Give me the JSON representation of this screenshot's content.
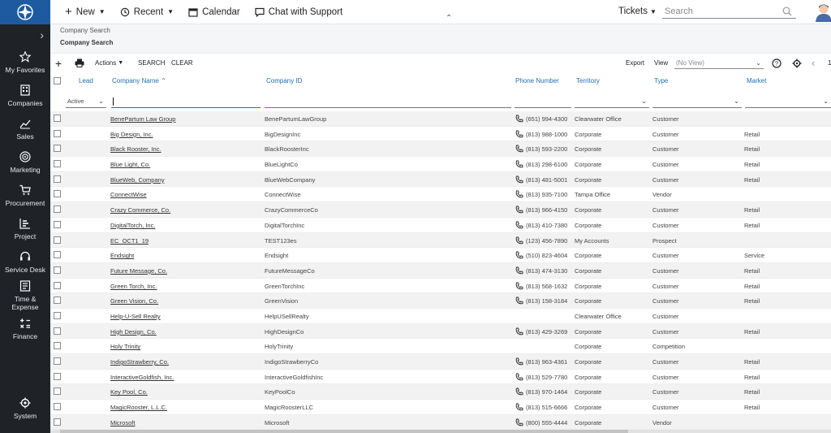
{
  "sidebar": {
    "items": [
      {
        "label": "My Favorites",
        "icon": "star-icon"
      },
      {
        "label": "Companies",
        "icon": "building-icon"
      },
      {
        "label": "Sales",
        "icon": "chart-icon"
      },
      {
        "label": "Marketing",
        "icon": "target-icon"
      },
      {
        "label": "Procurement",
        "icon": "cart-icon"
      },
      {
        "label": "Project",
        "icon": "project-icon"
      },
      {
        "label": "Service Desk",
        "icon": "headset-icon"
      },
      {
        "label": "Time &\nExpense",
        "icon": "time-expense-icon"
      },
      {
        "label": "Finance",
        "icon": "calculator-icon"
      }
    ],
    "system": "System"
  },
  "topbar": {
    "new": "New",
    "recent": "Recent",
    "calendar": "Calendar",
    "chat": "Chat with Support",
    "tickets": "Tickets",
    "search_placeholder": "Search"
  },
  "breadcrumb": {
    "parent": "Company Search",
    "current": "Company Search"
  },
  "toolbar": {
    "actions": "Actions",
    "search": "SEARCH",
    "clear": "CLEAR",
    "export": "Export",
    "view_label": "View",
    "view_value": "(No View)",
    "page_number": "1"
  },
  "columns": {
    "lead": "Lead",
    "company_name": "Company Name",
    "company_id": "Company ID",
    "phone": "Phone Number",
    "territory": "Territory",
    "type": "Type",
    "market": "Market"
  },
  "filters": {
    "status": "Active"
  },
  "rows": [
    {
      "name": "BenePartum Law Group",
      "id": "BenePartumLawGroup",
      "phone": "(651) 994-4300",
      "territory": "Clearwater Office",
      "type": "Customer",
      "market": ""
    },
    {
      "name": "Big Design, Inc.",
      "id": "BigDesignInc",
      "phone": "(813) 988-1000",
      "territory": "Corporate",
      "type": "Customer",
      "market": "Retail"
    },
    {
      "name": "Black Rooster, Inc.",
      "id": "BlackRoosterInc",
      "phone": "(813) 593-2200",
      "territory": "Corporate",
      "type": "Customer",
      "market": "Retail"
    },
    {
      "name": "Blue Light, Co.",
      "id": "BlueLightCo",
      "phone": "(813) 298-6100",
      "territory": "Corporate",
      "type": "Customer",
      "market": "Retail"
    },
    {
      "name": "BlueWeb, Company",
      "id": "BlueWebCompany",
      "phone": "(813) 481-5001",
      "territory": "Corporate",
      "type": "Customer",
      "market": "Retail"
    },
    {
      "name": "ConnectWise",
      "id": "ConnectWise",
      "phone": "(813) 935-7100",
      "territory": "Tampa Office",
      "type": "Vendor",
      "market": ""
    },
    {
      "name": "Crazy Commerce, Co.",
      "id": "CrazyCommerceCo",
      "phone": "(813) 966-4150",
      "territory": "Corporate",
      "type": "Customer",
      "market": "Retail"
    },
    {
      "name": "DigitalTorch, Inc.",
      "id": "DigitalTorchInc",
      "phone": "(813) 410-7380",
      "territory": "Corporate",
      "type": "Customer",
      "market": "Retail"
    },
    {
      "name": "EC_OCT1_19",
      "id": "TEST123es",
      "phone": "(123) 456-7890",
      "territory": "My Accounts",
      "type": "Prospect",
      "market": ""
    },
    {
      "name": "Endsight",
      "id": "Endsight",
      "phone": "(510) 823-4604",
      "territory": "Corporate",
      "type": "Customer",
      "market": "Service"
    },
    {
      "name": "Future Message, Co.",
      "id": "FutureMessageCo",
      "phone": "(813) 474-3130",
      "territory": "Corporate",
      "type": "Customer",
      "market": "Retail"
    },
    {
      "name": "Green Torch, Inc.",
      "id": "GreenTorchInc",
      "phone": "(813) 568-1632",
      "territory": "Corporate",
      "type": "Customer",
      "market": "Retail"
    },
    {
      "name": "Green Vision, Co.",
      "id": "GreenVision",
      "phone": "(813) 158-3184",
      "territory": "Corporate",
      "type": "Customer",
      "market": "Retail"
    },
    {
      "name": "Help-U-Sell Realty",
      "id": "HelpUSellRealty",
      "phone": "",
      "territory": "Clearwater Office",
      "type": "Customer",
      "market": ""
    },
    {
      "name": "High Design, Co.",
      "id": "HighDesignCo",
      "phone": "(813) 429-3269",
      "territory": "Corporate",
      "type": "Customer",
      "market": "Retail"
    },
    {
      "name": "Holy Trinity",
      "id": "HolyTrinity",
      "phone": "",
      "territory": "Corporate",
      "type": "Competition",
      "market": ""
    },
    {
      "name": "IndigoStrawberry, Co.",
      "id": "IndigoStrawberryCo",
      "phone": "(813) 963-4361",
      "territory": "Corporate",
      "type": "Customer",
      "market": "Retail"
    },
    {
      "name": "InteractiveGoldfish, Inc.",
      "id": "InteractiveGoldfishInc",
      "phone": "(813) 529-7780",
      "territory": "Corporate",
      "type": "Customer",
      "market": "Retail"
    },
    {
      "name": "Key Pool, Co.",
      "id": "KeyPoolCo",
      "phone": "(813) 970-1464",
      "territory": "Corporate",
      "type": "Customer",
      "market": "Retail"
    },
    {
      "name": "MagicRooster, L.L.C.",
      "id": "MagicRoosterLLC",
      "phone": "(813) 515-6666",
      "territory": "Corporate",
      "type": "Customer",
      "market": "Retail"
    },
    {
      "name": "Microsoft",
      "id": "Microsoft",
      "phone": "(800) 555-4444",
      "territory": "Corporate",
      "type": "Vendor",
      "market": ""
    }
  ]
}
